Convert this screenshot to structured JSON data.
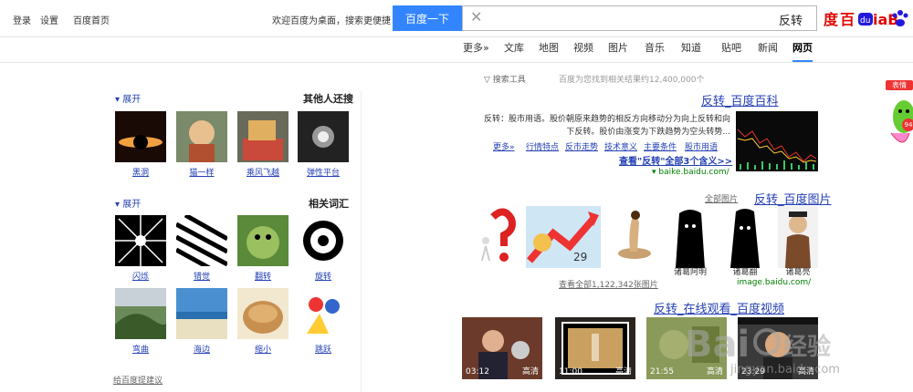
{
  "topbar": {
    "home_link": "百度首页",
    "settings_link": "设置",
    "login_link": "登录",
    "promo": "欢迎百度为桌面，搜索更便捷！",
    "search_value": "反转",
    "search_button": "百度一下",
    "logo_text": "Bai百度"
  },
  "tabs": [
    "网页",
    "新闻",
    "贴吧",
    "知道",
    "音乐",
    "图片",
    "视频",
    "地图",
    "文库",
    "更多»"
  ],
  "results_info": {
    "count": "百度为您找到相关结果约12,400,000个",
    "tools": "搜索工具"
  },
  "result1": {
    "title": "反转_百度百科",
    "snippet1": "反转：股市用语。股价朝原来趋势的相反方向移动分为向上反转和向",
    "snippet2": "下反转。股价由涨变为下跌趋势为空头转势...",
    "links": [
      "股市用语",
      "主要条件",
      "技术意义",
      "反市走势",
      "行情特点",
      "更多»"
    ],
    "more": "查看\"反转\"全部3个含义>>",
    "url": "baike.baidu.com/"
  },
  "result2": {
    "title": "反转_百度图片",
    "sub": "全部图片",
    "captions": [
      "诸葛亮",
      "诸葛翻",
      "诸葛阿明",
      "",
      "",
      ""
    ],
    "url": "image.baidu.com/",
    "more": "查看全部1,122,342张图片"
  },
  "result3": {
    "title": "反转_在线观看_百度视频",
    "videos": [
      {
        "dur": "03:12",
        "q": "高清"
      },
      {
        "dur": "11:00",
        "q": "高清"
      },
      {
        "dur": "21:55",
        "q": "高清"
      },
      {
        "dur": "23:29",
        "q": "高清"
      }
    ]
  },
  "right": {
    "section1": {
      "title": "其他人还搜",
      "expand": "展开",
      "items": [
        "黑洞",
        "猫一样",
        "乘风飞越",
        "弹性平台"
      ]
    },
    "section2": {
      "title": "相关词汇",
      "expand": "展开",
      "items": [
        "闪烁",
        "错觉",
        "翻转",
        "旋转",
        "弯曲",
        "海边",
        "缩小",
        "跳跃"
      ]
    },
    "feedback": "给百度提建议"
  },
  "watermark": "jingyan.baidu.com",
  "side_widget": {
    "label": "表情",
    "count": "94"
  }
}
